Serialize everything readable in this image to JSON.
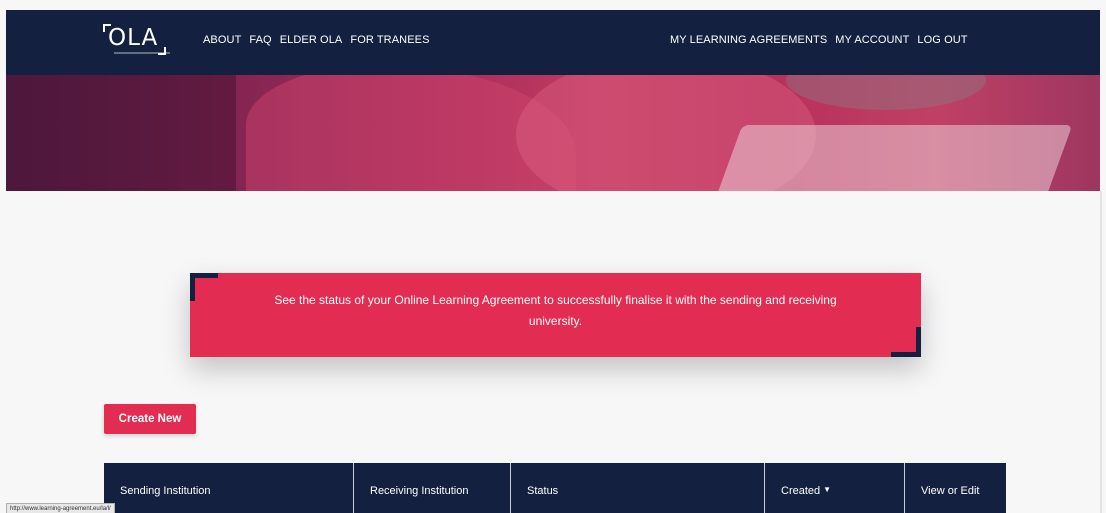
{
  "header": {
    "logo_text": "OLA",
    "nav_left": [
      "ABOUT",
      "FAQ",
      "ELDER OLA",
      "FOR TRANEES"
    ],
    "nav_right": [
      "MY LEARNING AGREEMENTS",
      "MY ACCOUNT",
      "LOG OUT"
    ]
  },
  "info_box": {
    "text": "See the status of your Online Learning Agreement to successfully finalise it with the sending and receiving university."
  },
  "actions": {
    "create_label": "Create New"
  },
  "table": {
    "columns": [
      "Sending Institution",
      "Receiving Institution",
      "Status",
      "Created",
      "View or Edit"
    ],
    "sort_icon": "sort-desc-icon"
  },
  "status_bar": {
    "url": "http://www.learning-agreement.eu/la/l/"
  },
  "colors": {
    "navy": "#13203f",
    "accent": "#e22c51",
    "background": "#f7f7f8"
  }
}
